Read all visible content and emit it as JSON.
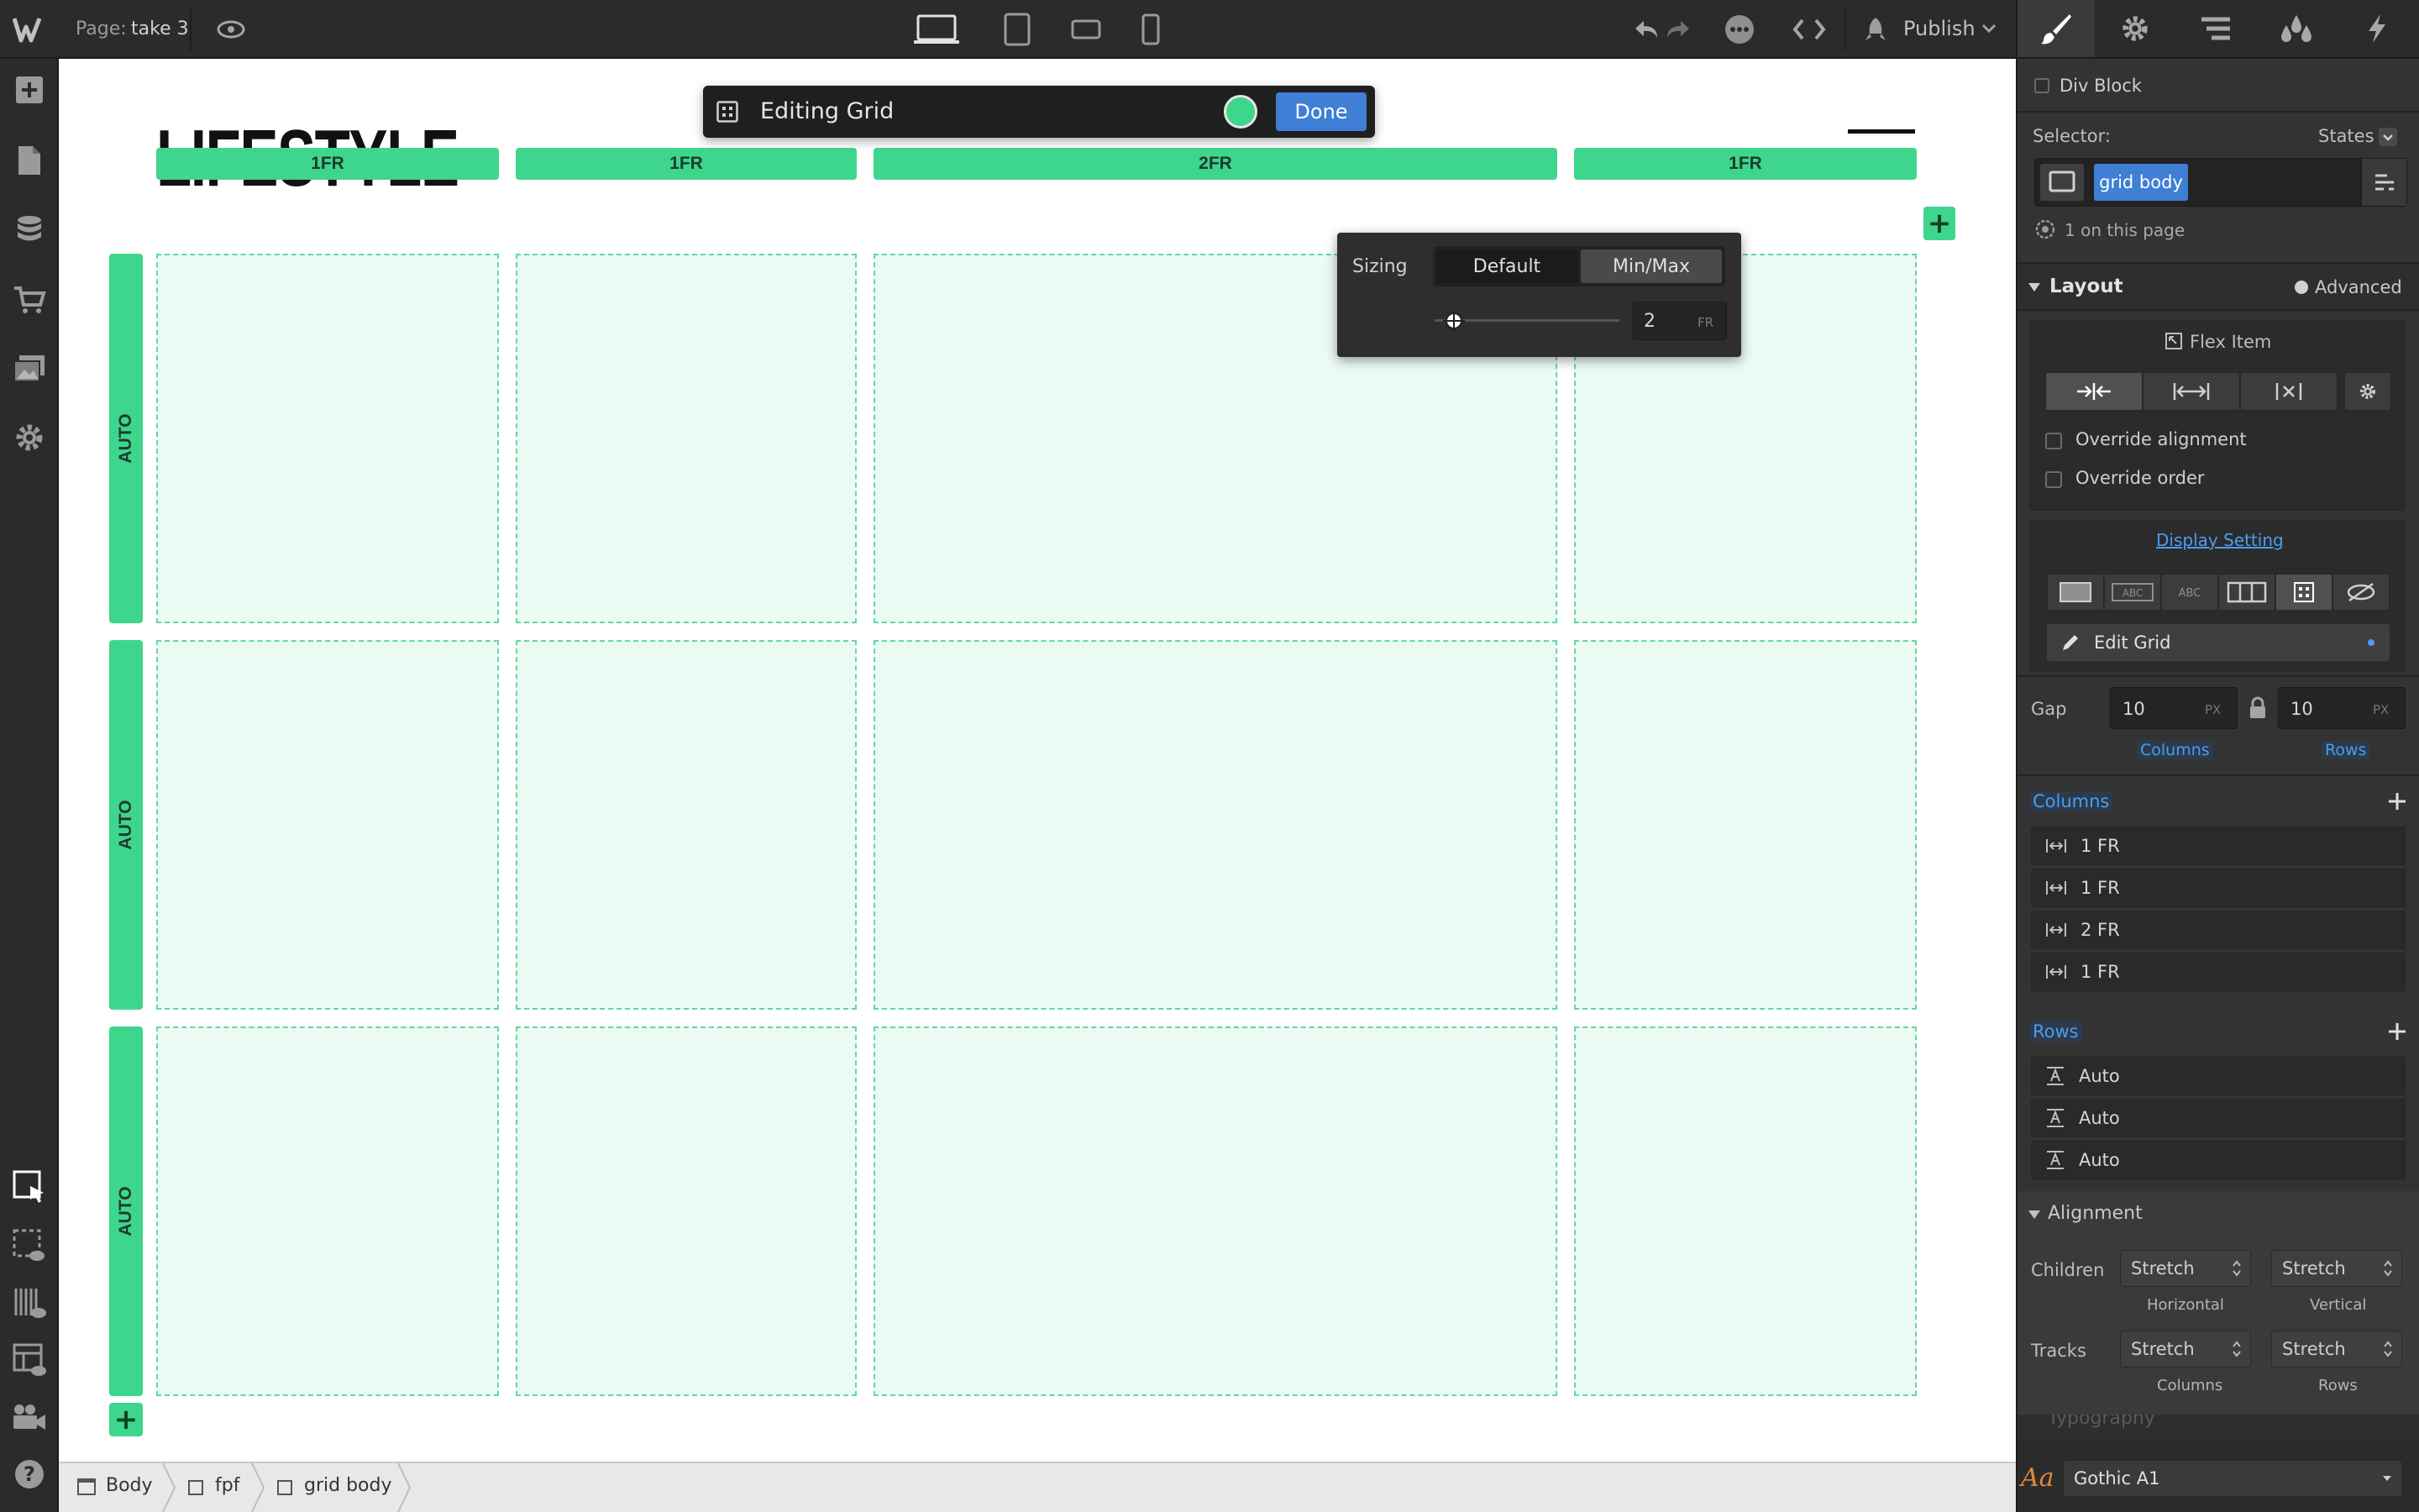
{
  "topbar": {
    "page_prefix": "Page:",
    "page_name": "take 3",
    "publish_label": "Publish"
  },
  "edit_toolbar": {
    "title": "Editing Grid",
    "done_label": "Done"
  },
  "sizing_popover": {
    "label": "Sizing",
    "tab_default": "Default",
    "tab_minmax": "Min/Max",
    "value": "2",
    "unit": "FR"
  },
  "canvas": {
    "logo": "LIFESTYLE",
    "columns": [
      "1FR",
      "1FR",
      "2FR",
      "1FR"
    ],
    "rows": [
      "AUTO",
      "AUTO",
      "AUTO"
    ],
    "add_column": "+",
    "add_row": "+"
  },
  "breadcrumb": {
    "items": [
      "Body",
      "fpf",
      "grid body"
    ]
  },
  "panel": {
    "element_label": "Div Block",
    "selector_label": "Selector:",
    "states_label": "States",
    "class_chip": "grid body",
    "on_page": "1 on this page",
    "layout_title": "Layout",
    "advanced_label": "Advanced",
    "flex_item_label": "Flex Item",
    "override_alignment": "Override alignment",
    "override_order": "Override order",
    "display_setting": "Display Setting",
    "edit_grid": "Edit Grid",
    "gap_label": "Gap",
    "gap_columns_value": "10",
    "gap_rows_value": "10",
    "gap_unit": "PX",
    "gap_columns_label": "Columns",
    "gap_rows_label": "Rows",
    "columns_title": "Columns",
    "columns": [
      "1 FR",
      "1 FR",
      "2 FR",
      "1 FR"
    ],
    "rows_title": "Rows",
    "rows": [
      "Auto",
      "Auto",
      "Auto"
    ],
    "alignment_title": "Alignment",
    "children_label": "Children",
    "tracks_label": "Tracks",
    "children_h": "Stretch",
    "children_v": "Stretch",
    "tracks_c": "Stretch",
    "tracks_r": "Stretch",
    "horizontal_label": "Horizontal",
    "vertical_label": "Vertical",
    "columns_sub": "Columns",
    "rows_sub": "Rows",
    "typography_title": "Typography",
    "font_prefix": "Aa",
    "font_value": "Gothic A1"
  },
  "colors": {
    "grid_green": "#3dd68c",
    "accent_blue": "#4b9cf0",
    "done_blue": "#3f7fd6",
    "status_green": "#3dd68c"
  }
}
